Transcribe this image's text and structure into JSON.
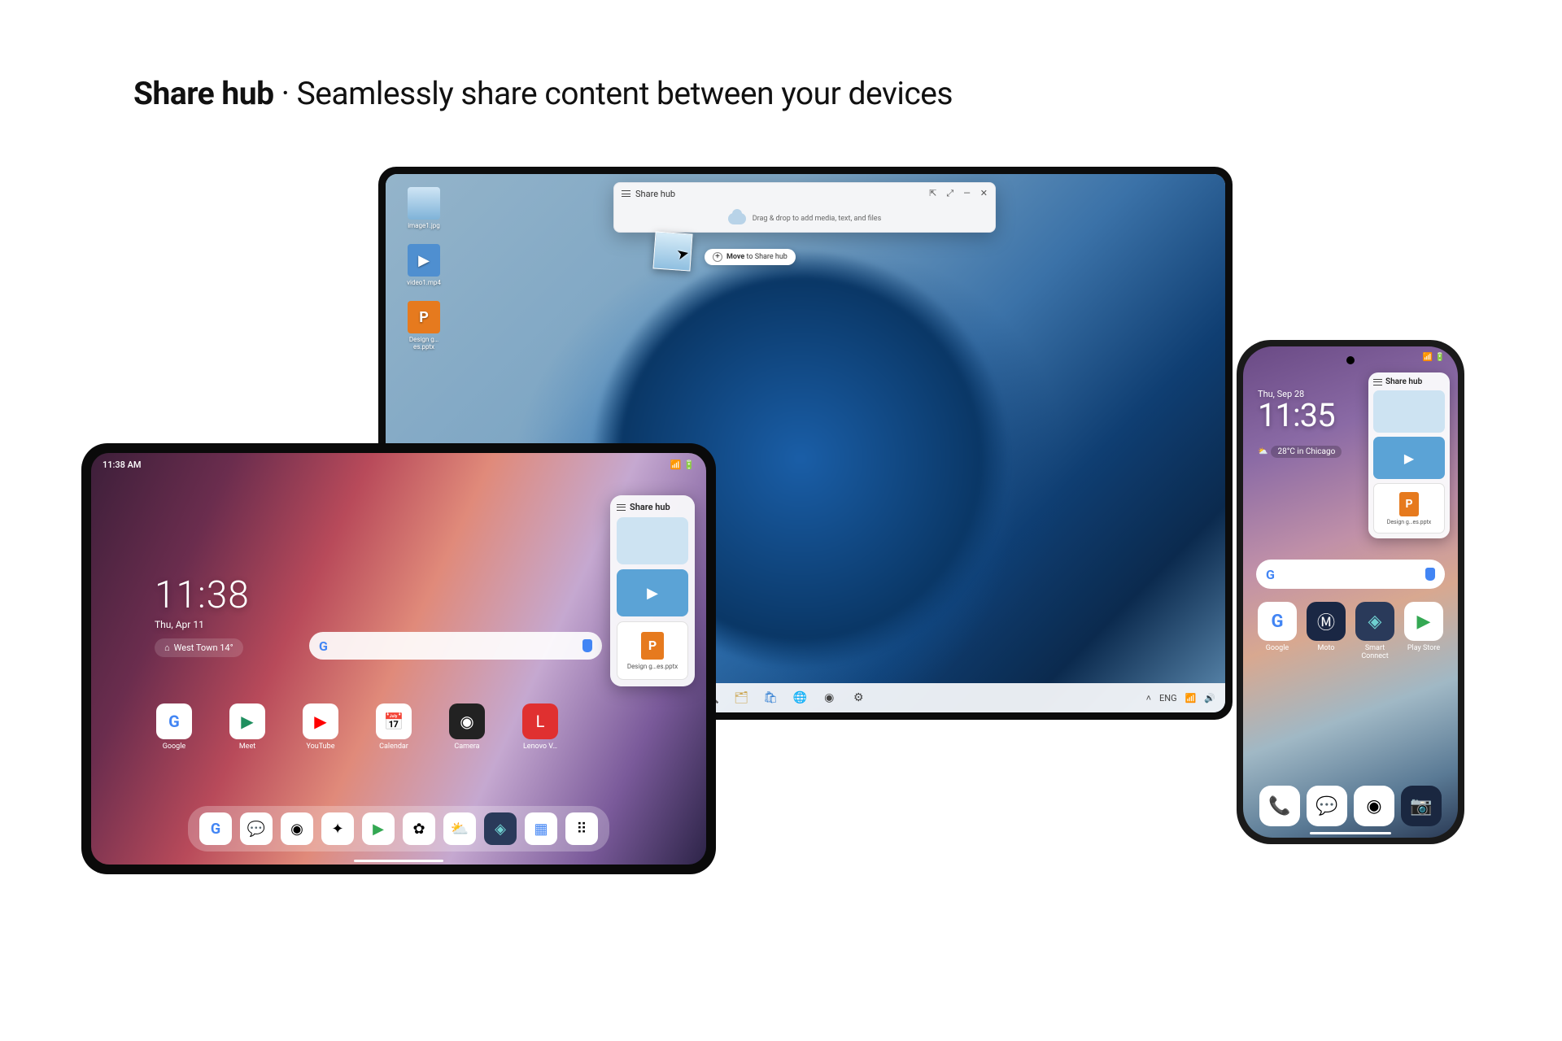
{
  "heading": {
    "title": "Share hub",
    "sep": " · ",
    "tag": "Seamlessly share content between your devices"
  },
  "laptop": {
    "desktop_icons": [
      {
        "label": "image1.jpg",
        "kind": "image"
      },
      {
        "label": "video1.mp4",
        "kind": "video"
      },
      {
        "label": "Design g…es.pptx",
        "kind": "pptx"
      }
    ],
    "share_hub": {
      "title": "Share hub",
      "hint": "Drag & drop to add media, text, and files",
      "controls": {
        "pin": "⇱",
        "expand": "⤢",
        "min": "—",
        "close": "✕"
      }
    },
    "drag_tooltip": {
      "action": "Move",
      "to": " to Share hub",
      "plus": "+"
    },
    "taskbar": {
      "apps": [
        "start",
        "search",
        "explorer",
        "store",
        "edge",
        "chrome",
        "settings"
      ],
      "tray": {
        "chevron": "˄",
        "lang": "ENG",
        "wifi": "📶",
        "vol": "🔊",
        "time_block": ""
      }
    }
  },
  "tablet": {
    "status": {
      "time": "11:38 AM",
      "icons": "📶 🔋"
    },
    "clock": {
      "time": "11:38",
      "date": "Thu, Apr 11"
    },
    "weather": {
      "text": "West Town 14°",
      "icon": "⌂"
    },
    "apps": [
      {
        "label": "Google"
      },
      {
        "label": "Meet"
      },
      {
        "label": "YouTube"
      },
      {
        "label": "Calendar"
      },
      {
        "label": "Camera"
      },
      {
        "label": "Lenovo V…"
      }
    ],
    "share_hub": {
      "title": "Share hub",
      "file_label": "Design g…es.pptx"
    }
  },
  "phone": {
    "status": {
      "l": "",
      "r": "📶 🔋"
    },
    "clock": {
      "date": "Thu, Sep 28",
      "time": "11:35"
    },
    "weather": {
      "text": "28°C in Chicago"
    },
    "apps": [
      {
        "label": "Google"
      },
      {
        "label": "Moto"
      },
      {
        "label": "Smart Connect"
      },
      {
        "label": "Play Store"
      }
    ],
    "share_hub": {
      "title": "Share hub",
      "file_label": "Design g…es.pptx"
    }
  }
}
